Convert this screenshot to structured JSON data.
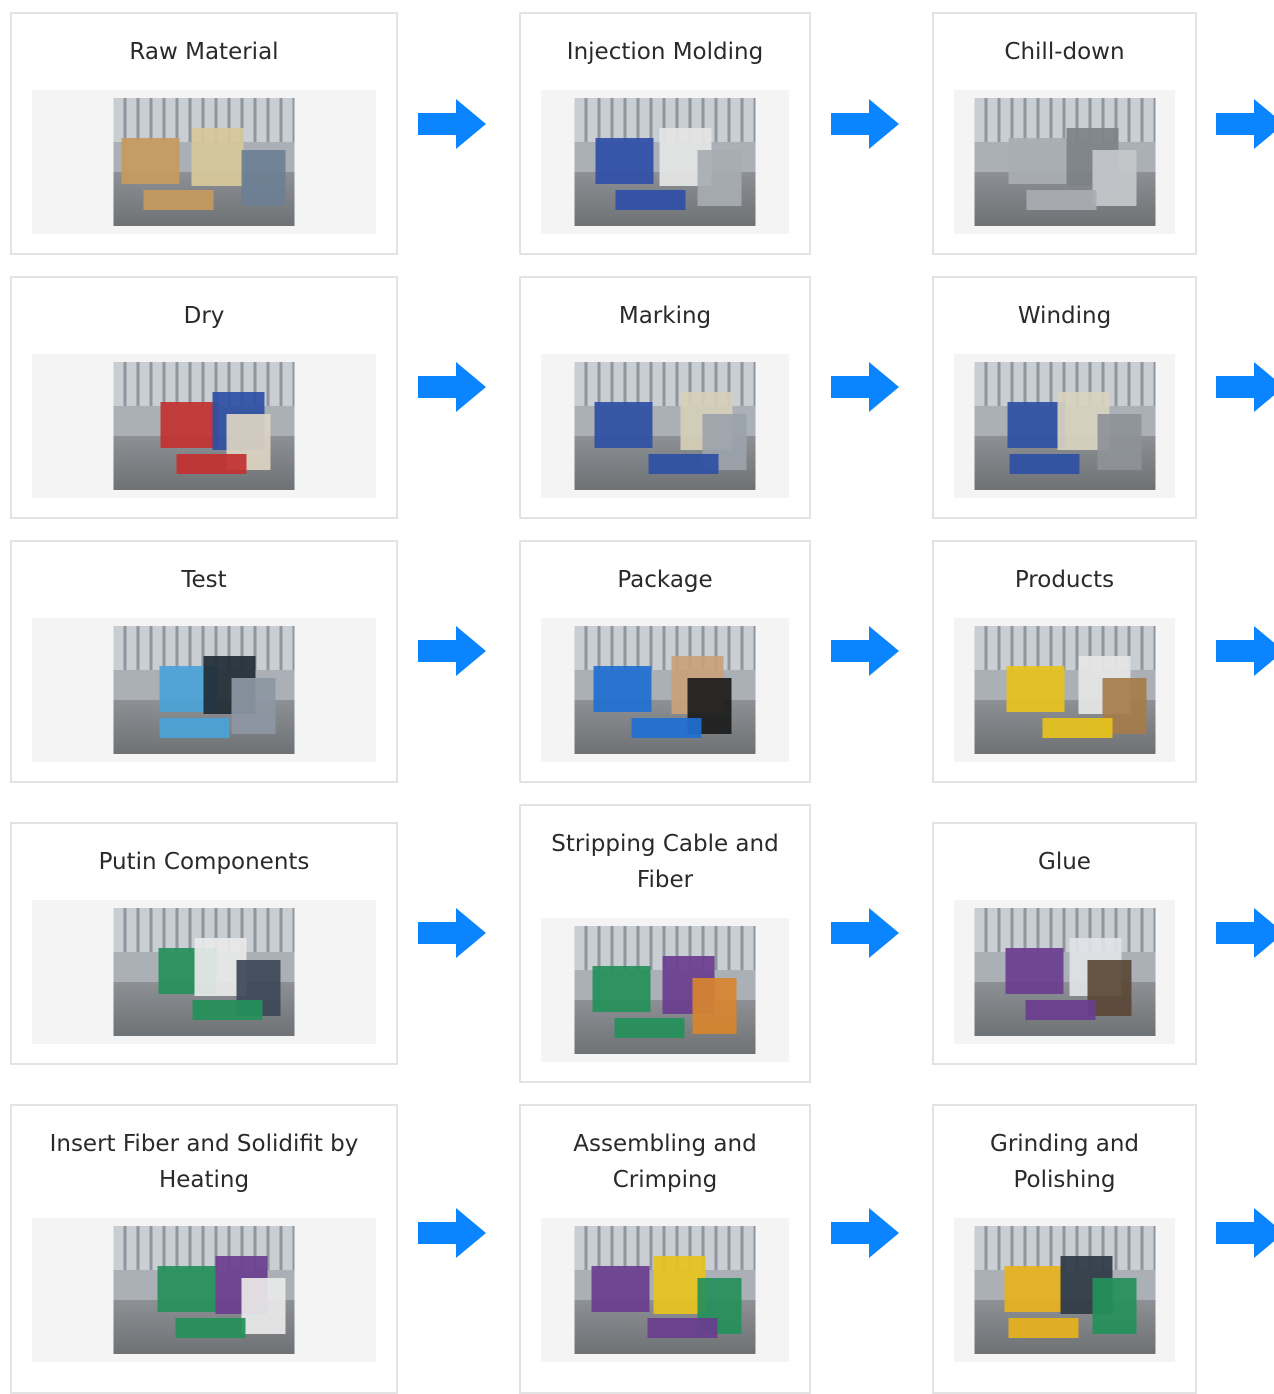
{
  "colors": {
    "arrow": "#0a84ff",
    "card_border": "#e3e3e3",
    "photo_frame": "#f4f4f4",
    "title_text": "#2a2a2a"
  },
  "steps": [
    {
      "title": "Raw Material",
      "icon": "factory-photo",
      "tones": [
        "#c79a5e",
        "#d8c89a",
        "#6d7f94"
      ]
    },
    {
      "title": "Injection Molding",
      "icon": "factory-photo",
      "tones": [
        "#2f4ea8",
        "#e5e5e5",
        "#a7adb3"
      ]
    },
    {
      "title": "Chill-down",
      "icon": "factory-photo",
      "tones": [
        "#a9aeb2",
        "#7d8288",
        "#c4c8cb"
      ]
    },
    {
      "title": "Dry",
      "icon": "factory-photo",
      "tones": [
        "#c23131",
        "#2e4fa4",
        "#ddd4c2"
      ]
    },
    {
      "title": "Marking",
      "icon": "factory-photo",
      "tones": [
        "#2e4fa4",
        "#d6cfb8",
        "#9ba3aa"
      ]
    },
    {
      "title": "Winding",
      "icon": "factory-photo",
      "tones": [
        "#2e4fa4",
        "#d9d2bf",
        "#8e9397"
      ]
    },
    {
      "title": "Test",
      "icon": "factory-photo",
      "tones": [
        "#4aa3d8",
        "#222c36",
        "#8d97a3"
      ]
    },
    {
      "title": "Package",
      "icon": "factory-photo",
      "tones": [
        "#1f6fd1",
        "#c9a27a",
        "#1b1b1b"
      ]
    },
    {
      "title": "Products",
      "icon": "factory-photo",
      "tones": [
        "#e7c21c",
        "#e6e6e6",
        "#a57c4b"
      ]
    },
    {
      "title": "Putin Components",
      "icon": "factory-photo",
      "tones": [
        "#24905a",
        "#e9e9e9",
        "#3d4656"
      ]
    },
    {
      "title": "Stripping Cable and Fiber",
      "icon": "factory-photo",
      "tones": [
        "#24905a",
        "#6a3d8f",
        "#d7862f"
      ]
    },
    {
      "title": "Glue",
      "icon": "factory-photo",
      "tones": [
        "#6a3d8f",
        "#e0e3e6",
        "#5b4636"
      ]
    },
    {
      "title": "Insert Fiber and Solidifit by Heating",
      "icon": "factory-photo",
      "tones": [
        "#24905a",
        "#6a3d8f",
        "#e9e9e9"
      ]
    },
    {
      "title": "Assembling and Crimping",
      "icon": "factory-photo",
      "tones": [
        "#6a3d8f",
        "#e8c21c",
        "#24905a"
      ]
    },
    {
      "title": "Grinding and Polishing",
      "icon": "factory-photo",
      "tones": [
        "#e7b21c",
        "#2f3a45",
        "#24905a"
      ]
    }
  ],
  "arrow_icon": "arrow-right-icon"
}
